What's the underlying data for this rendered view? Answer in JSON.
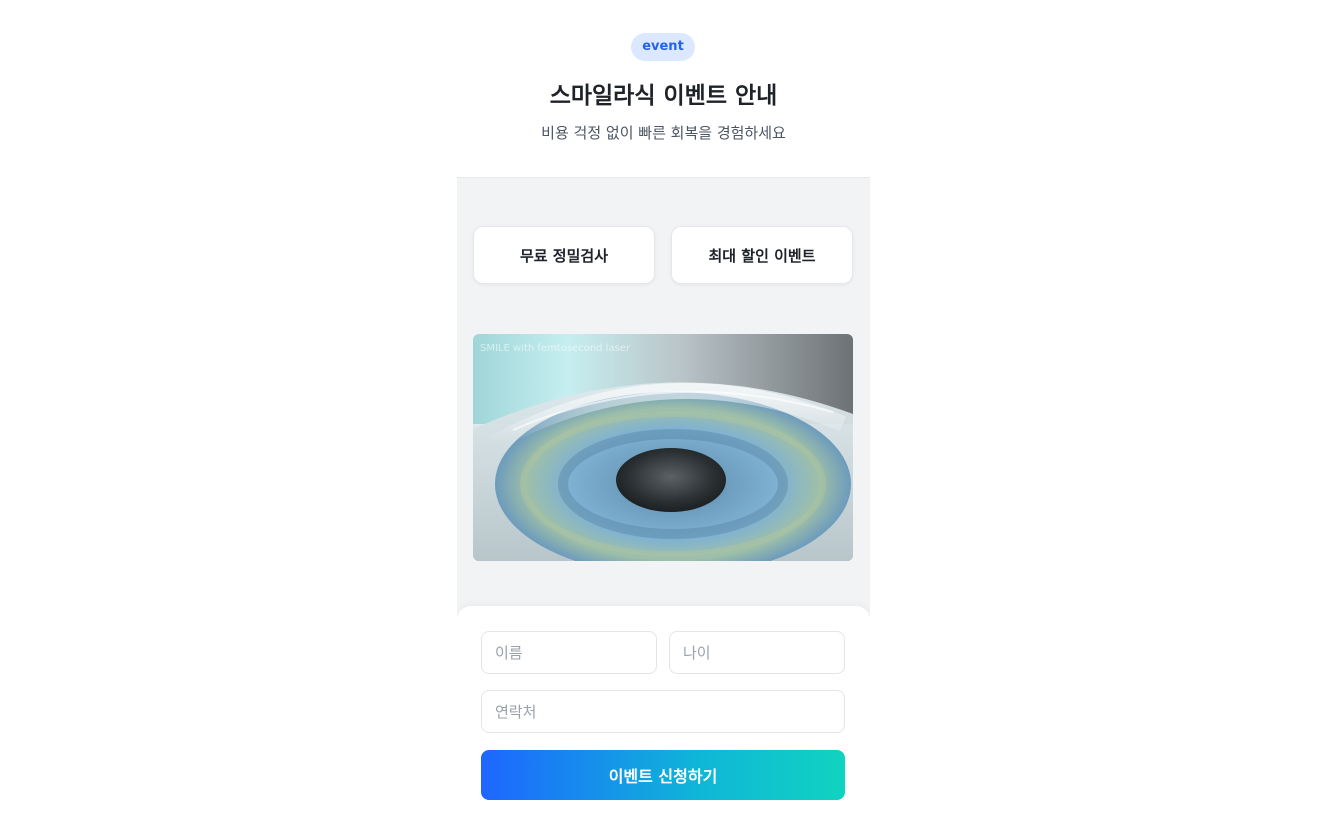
{
  "header": {
    "badge": "event",
    "title": "스마일라식 이벤트 안내",
    "subtitle": "비용 걱정 없이 빠른 회복을 경험하세요"
  },
  "features": [
    {
      "label": "무료 정밀검사"
    },
    {
      "label": "최대 할인 이벤트"
    }
  ],
  "hero": {
    "caption": "SMILE with femtosecond laser"
  },
  "form": {
    "name_placeholder": "이름",
    "age_placeholder": "나이",
    "phone_placeholder": "연락처",
    "submit_label": "이벤트 신청하기"
  },
  "colors": {
    "badge_bg": "#dbe8ff",
    "badge_text": "#2563eb",
    "gradient_start": "#1e66ff",
    "gradient_end": "#10d3c0"
  }
}
